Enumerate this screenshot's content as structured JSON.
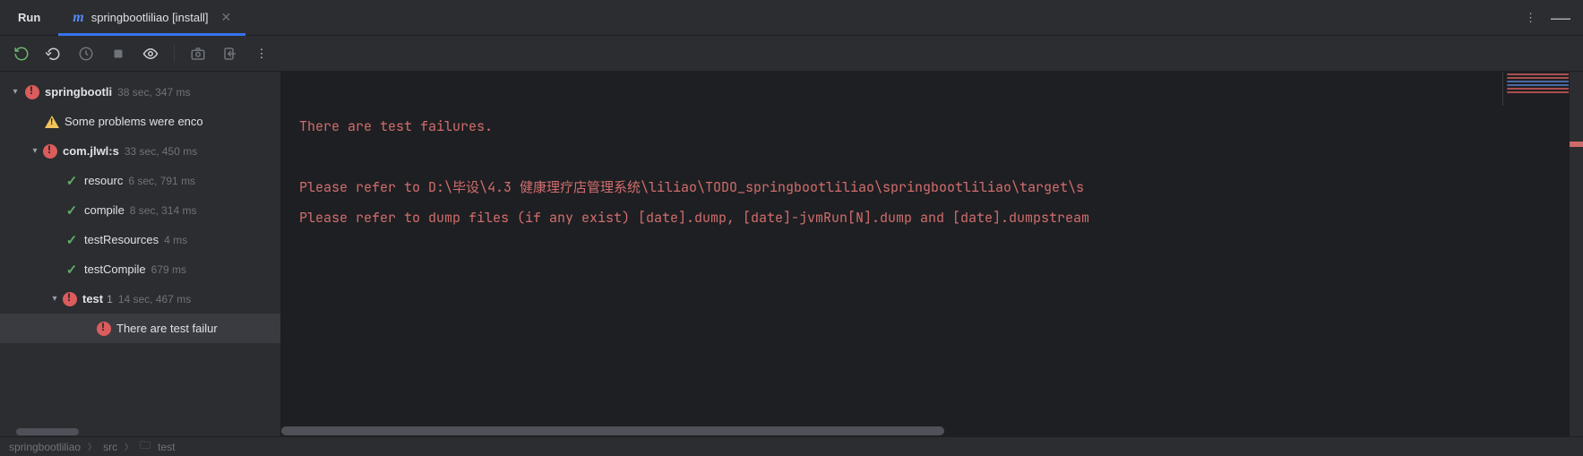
{
  "tabs": {
    "run": "Run",
    "active": {
      "name": "springbootliliao [install]"
    }
  },
  "tree": {
    "root": {
      "label": "springbootli",
      "timing": "38 sec, 347 ms"
    },
    "warn": {
      "label": "Some problems were enco"
    },
    "module": {
      "label": "com.jlwl:s",
      "timing": "33 sec, 450 ms"
    },
    "steps": [
      {
        "label": "resourc",
        "timing": "6 sec, 791 ms"
      },
      {
        "label": "compile",
        "timing": "8 sec, 314 ms"
      },
      {
        "label": "testResources",
        "timing": "4 ms"
      },
      {
        "label": "testCompile",
        "timing": "679 ms"
      }
    ],
    "test": {
      "label": "test",
      "count": "1",
      "timing": "14 sec, 467 ms"
    },
    "failure": {
      "label": "There are test failur"
    }
  },
  "console": {
    "line1": "There are test failures.",
    "line2": "",
    "line3": "Please refer to D:\\毕设\\4.3 健康理疗店管理系统\\liliao\\TODO_springbootliliao\\springbootliliao\\target\\s",
    "line4": "Please refer to dump files (if any exist) [date].dump, [date]-jvmRun[N].dump and [date].dumpstream"
  },
  "footer": {
    "crumb1": "springbootliliao",
    "crumb2": "src",
    "crumb3": "test"
  }
}
